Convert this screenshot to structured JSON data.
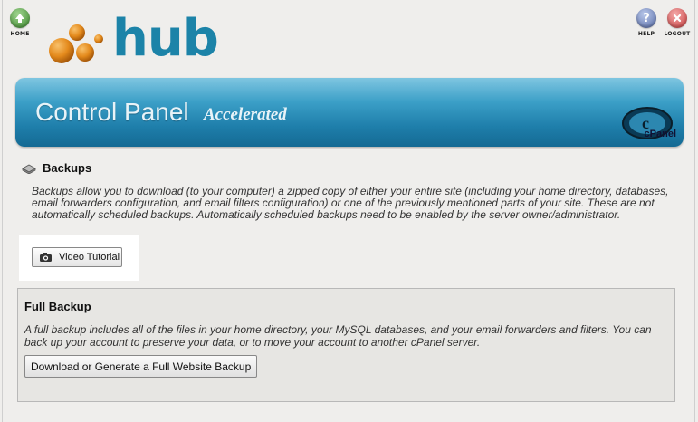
{
  "nav": {
    "home_label": "HOME",
    "help_label": "HELP",
    "logout_label": "LOGOUT"
  },
  "logo": {
    "text": "hub"
  },
  "banner": {
    "title": "Control Panel",
    "subtitle": "Accelerated",
    "brand": "cPanel"
  },
  "section": {
    "title": "Backups",
    "description": "Backups allow you to download (to your computer) a zipped copy of either your entire site (including your home directory, databases, email forwarders configuration, and email filters configuration) or one of the previously mentioned parts of your site. These are not automatically scheduled backups. Automatically scheduled backups need to be enabled by the server owner/administrator."
  },
  "video_tutorial": {
    "label": "Video Tutorial"
  },
  "full_backup": {
    "title": "Full Backup",
    "description": "A full backup includes all of the files in your home directory, your MySQL databases, and your email forwarders and filters. You can back up your account to preserve your data, or to move your account to another cPanel server.",
    "button_label": "Download or Generate a Full Website Backup"
  },
  "colors": {
    "banner_blue": "#1f7fab",
    "logo_orange": "#e48a1c",
    "logo_blue": "#1c83a8"
  }
}
